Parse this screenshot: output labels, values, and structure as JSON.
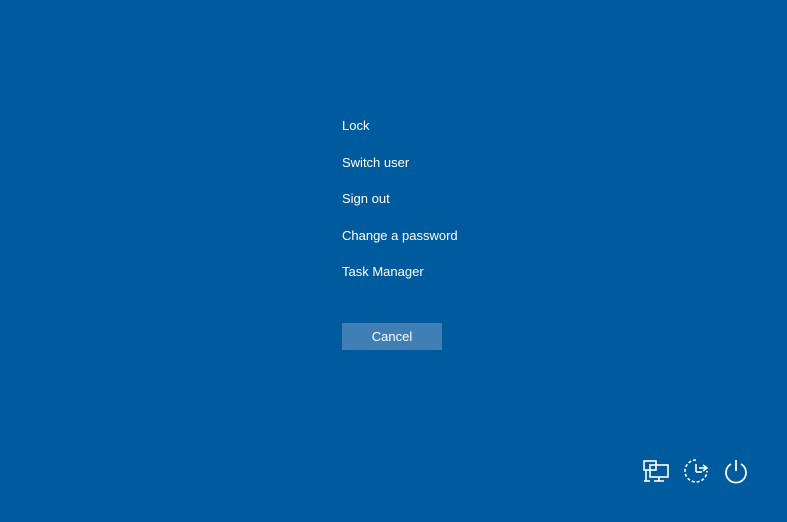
{
  "menu": {
    "items": [
      {
        "label": "Lock"
      },
      {
        "label": "Switch user"
      },
      {
        "label": "Sign out"
      },
      {
        "label": "Change a password"
      },
      {
        "label": "Task Manager"
      }
    ]
  },
  "cancel_button": {
    "label": "Cancel"
  },
  "tray": {
    "icons": [
      "network-icon",
      "ease-of-access-icon",
      "power-icon"
    ]
  },
  "colors": {
    "background": "#005a9e",
    "button": "#3f7fb6",
    "text": "#ffffff"
  }
}
